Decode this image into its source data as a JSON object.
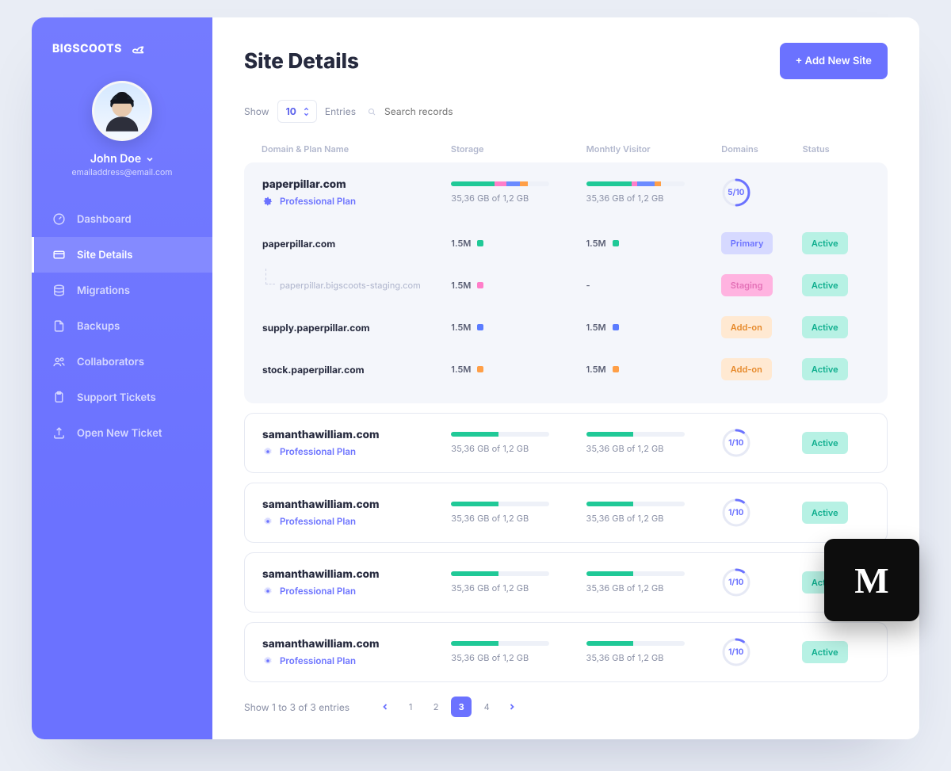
{
  "brand": "BIGSCOOTS",
  "user": {
    "name": "John Doe",
    "email": "emailaddress@email.com"
  },
  "nav": {
    "dashboard": "Dashboard",
    "site_details": "Site Details",
    "migrations": "Migrations",
    "backups": "Backups",
    "collaborators": "Collaborators",
    "support": "Support Tickets",
    "open_ticket": "Open New Ticket"
  },
  "page": {
    "title": "Site Details",
    "add_new_site": "+ Add New Site"
  },
  "filters": {
    "show": "Show",
    "entries_value": "10",
    "entries": "Entries",
    "search_placeholder": "Search records"
  },
  "columns": {
    "domain": "Domain & Plan Name",
    "storage": "Storage",
    "visitor": "Monhtly Visitor",
    "domains": "Domains",
    "status": "Status"
  },
  "metric_text": "35,36 GB of 1,2 GB",
  "plan": "Professional Plan",
  "expanded": {
    "domain": "paperpillar.com",
    "domains_count": "5/10",
    "rows": [
      {
        "dm": "paperpillar.com",
        "s": "1.5M",
        "sdot": "d-green",
        "v": "1.5M",
        "vdot": "d-green",
        "tag": "Primary",
        "tagc": "b-primary",
        "status": "Active",
        "child": false
      },
      {
        "dm": "paperpillar.bigscoots-staging.com",
        "s": "1.5M",
        "sdot": "d-pink",
        "v": "-",
        "vdot": "",
        "tag": "Staging",
        "tagc": "b-staging",
        "status": "Active",
        "child": true
      },
      {
        "dm": "supply.paperpillar.com",
        "s": "1.5M",
        "sdot": "d-blue",
        "v": "1.5M",
        "vdot": "d-blue",
        "tag": "Add-on",
        "tagc": "b-addon",
        "status": "Active",
        "child": false
      },
      {
        "dm": "stock.paperpillar.com",
        "s": "1.5M",
        "sdot": "d-orange",
        "v": "1.5M",
        "vdot": "d-orange",
        "tag": "Add-on",
        "tagc": "b-addon",
        "status": "Active",
        "child": false
      }
    ]
  },
  "sites": [
    {
      "domain": "samanthawilliam.com",
      "domains_count": "1/10",
      "status": "Active"
    },
    {
      "domain": "samanthawilliam.com",
      "domains_count": "1/10",
      "status": "Active"
    },
    {
      "domain": "samanthawilliam.com",
      "domains_count": "1/10",
      "status": "Active"
    },
    {
      "domain": "samanthawilliam.com",
      "domains_count": "1/10",
      "status": "Active"
    }
  ],
  "pager": {
    "summary": "Show 1 to 3 of 3 entries",
    "pages": [
      "1",
      "2",
      "3",
      "4"
    ],
    "active": "3"
  },
  "medium": "M"
}
